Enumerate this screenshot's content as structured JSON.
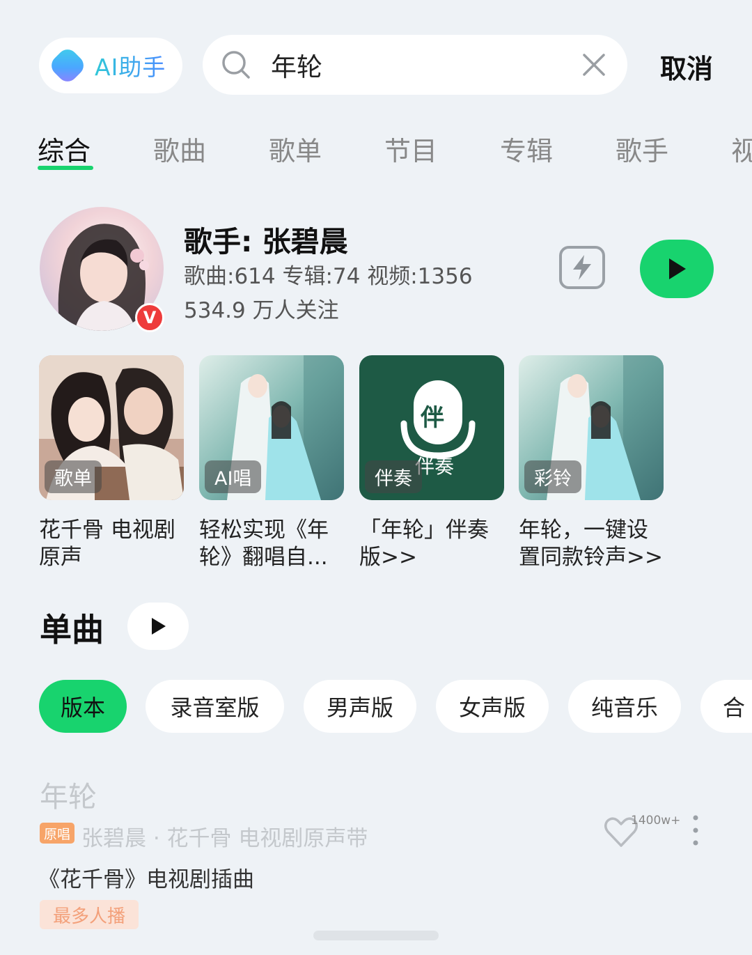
{
  "top_bar": {
    "ai_label": "AI助手",
    "search_value": "年轮",
    "cancel_label": "取消"
  },
  "tabs": [
    {
      "label": "综合",
      "active": true
    },
    {
      "label": "歌曲"
    },
    {
      "label": "歌单"
    },
    {
      "label": "节目"
    },
    {
      "label": "专辑"
    },
    {
      "label": "歌手"
    },
    {
      "label": "视"
    }
  ],
  "artist": {
    "name": "歌手: 张碧晨",
    "stats": "歌曲:614 专辑:74 视频:1356",
    "fans": "534.9 万人关注",
    "verified_badge": "V"
  },
  "cards": [
    {
      "tag": "歌单",
      "title": "花千骨 电视剧原声"
    },
    {
      "tag": "AI唱",
      "title": "轻松实现《年轮》翻唱自..."
    },
    {
      "tag": "伴奏",
      "title": "「年轮」伴奏版>>",
      "art_icon_text": "伴",
      "art_caption": "伴奏"
    },
    {
      "tag": "彩铃",
      "title": "年轮，一键设置同款铃声>>"
    }
  ],
  "singles": {
    "title": "单曲",
    "chips": [
      {
        "label": "版本",
        "active": true
      },
      {
        "label": "录音室版"
      },
      {
        "label": "男声版"
      },
      {
        "label": "女声版"
      },
      {
        "label": "纯音乐"
      },
      {
        "label": "合"
      }
    ]
  },
  "song": {
    "title": "年轮",
    "orig_tag": "原唱",
    "meta": "张碧晨 · 花千骨 电视剧原声带",
    "description": "《花千骨》电视剧插曲",
    "hot_tag": "最多人播",
    "like_count": "1400w+"
  },
  "colors": {
    "accent": "#18d36e",
    "background": "#eef2f6",
    "orig_tag": "#f7a468",
    "hot_tag_text": "#f3a07a"
  }
}
